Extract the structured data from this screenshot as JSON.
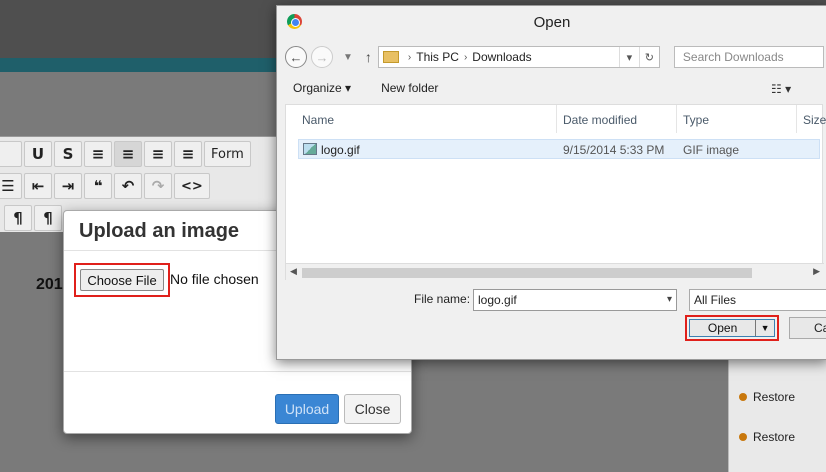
{
  "editor": {
    "toolbar_row1": [
      "U",
      "S",
      "≡",
      "≡",
      "≡",
      "≡",
      "Form"
    ],
    "toolbar_row2": [
      "☰",
      "⇤",
      "⇥",
      "❝",
      "↶",
      "↷",
      "<>"
    ],
    "toolbar_row3": [
      "¶",
      "¶"
    ],
    "doc_text": "201",
    "restore_label": "Restore"
  },
  "upload_modal": {
    "title": "Upload an image",
    "choose_file_label": "Choose File",
    "no_file_text": "No file chosen",
    "upload_label": "Upload",
    "close_label": "Close"
  },
  "open_dialog": {
    "title": "Open",
    "breadcrumb": [
      "This PC",
      "Downloads"
    ],
    "search_placeholder": "Search Downloads",
    "organize_label": "Organize ▾",
    "new_folder_label": "New folder",
    "columns": [
      "Name",
      "Date modified",
      "Type",
      "Size"
    ],
    "files": [
      {
        "name": "logo.gif",
        "date": "9/15/2014 5:33 PM",
        "type": "GIF image"
      }
    ],
    "file_name_label": "File name:",
    "file_name_value": "logo.gif",
    "file_type_value": "All Files",
    "open_label": "Open",
    "cancel_label": "Cancel"
  },
  "colors": {
    "highlight": "#e0201b",
    "upload_button": "#3a86d4",
    "teal_bar": "#1f5f6a"
  }
}
